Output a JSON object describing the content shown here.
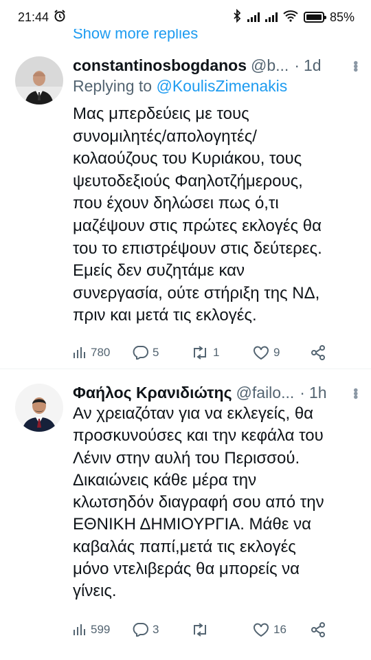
{
  "status_bar": {
    "time": "21:44",
    "battery": "85%"
  },
  "thread": {
    "show_more_replies": "Show more replies"
  },
  "tweets": [
    {
      "name": "constantinosbogdanos",
      "handle": "@b...",
      "time": "1d",
      "replying_prefix": "Replying to ",
      "replying_to": "@KoulisZimenakis",
      "lines": [
        "Μας μπερδεύεις με τους",
        "συνομιλητές/απολογητές/",
        "κολαούζους του Κυριάκου, τους",
        "ψευτοδεξιούς Φαηλοτζήμερους,",
        "που έχουν δηλώσει πως ό,τι",
        "μαζέψουν στις πρώτες εκλογές θα",
        "του το επιστρέψουν στις δεύτερες.",
        "Εμείς δεν συζητάμε καν",
        "συνεργασία, ούτε στήριξη της ΝΔ,",
        "πριν και μετά τις εκλογές."
      ],
      "views": "780",
      "replies": "5",
      "retweets": "1",
      "likes": "9"
    },
    {
      "name": "Φαήλος Κρανιδιώτης",
      "handle": "@failo...",
      "time": "1h",
      "lines": [
        "Αν χρειαζόταν για να εκλεγείς, θα",
        "προσκυνούσες και την κεφάλα του",
        "Λένιν στην αυλή του Περισσού.",
        "Δικαιώνεις κάθε μέρα την",
        "κλωτσηδόν διαγραφή σου από την",
        "ΕΘΝΙΚΗ ΔΗΜΙΟΥΡΓΙΑ. Μάθε να",
        "καβαλάς παπί,μετά τις εκλογές",
        "μόνο ντελιβεράς θα μπορείς να",
        "γίνεις."
      ],
      "views": "599",
      "replies": "3",
      "retweets": "",
      "likes": "16"
    }
  ],
  "colors": {
    "accent": "#1d9bf0",
    "secondary_text": "#536471",
    "primary_text": "#0f1419"
  }
}
